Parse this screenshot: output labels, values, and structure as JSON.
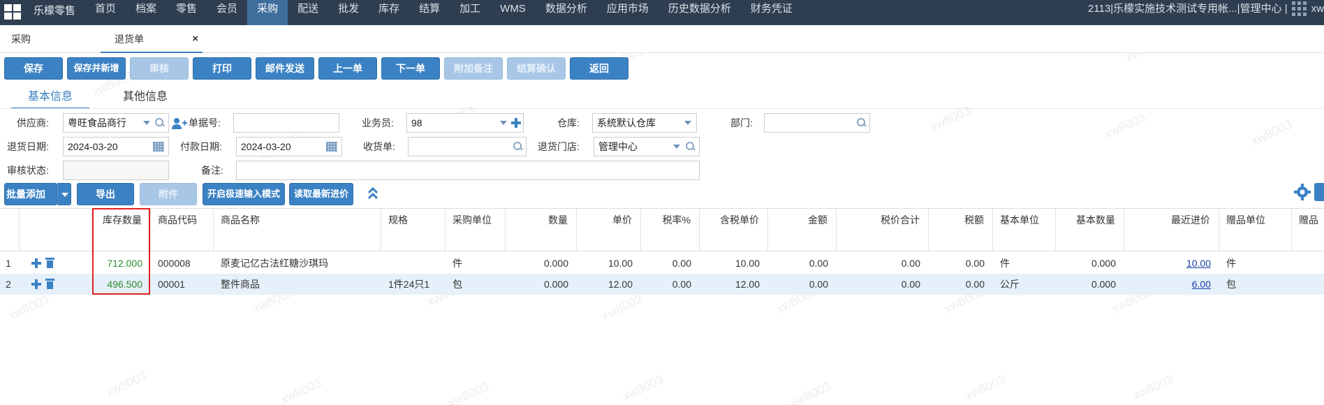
{
  "app": {
    "brand": "乐檬零售",
    "user_info": "2113|乐檬实施技术测试专用帐...|管理中心 |",
    "user": "xw"
  },
  "nav": [
    "首页",
    "档案",
    "零售",
    "会员",
    "采购",
    "配送",
    "批发",
    "库存",
    "结算",
    "加工",
    "WMS",
    "数据分析",
    "应用市场",
    "历史数据分析",
    "财务凭证"
  ],
  "nav_active": "采购",
  "tabs": {
    "purchase": "采购",
    "return": "退货单",
    "close": "×"
  },
  "toolbar": [
    "保存",
    "保存并新增",
    "审核",
    "打印",
    "邮件发送",
    "上一单",
    "下一单",
    "附加备注",
    "结算确认",
    "返回"
  ],
  "subtabs": {
    "basic": "基本信息",
    "other": "其他信息"
  },
  "form": {
    "supplier_label": "供应商:",
    "supplier_value": "粤旺食品商行",
    "doc_no_label": "单据号:",
    "doc_no_value": "",
    "salesman_label": "业务员:",
    "salesman_value": "98",
    "warehouse_label": "仓库:",
    "warehouse_value": "系统默认仓库",
    "dept_label": "部门:",
    "dept_value": "",
    "return_date_label": "退货日期:",
    "return_date_value": "2024-03-20",
    "pay_date_label": "付款日期:",
    "pay_date_value": "2024-03-20",
    "receipt_label": "收货单:",
    "receipt_value": "",
    "store_label": "退货门店:",
    "store_value": "管理中心",
    "audit_label": "审核状态:",
    "audit_value": "",
    "note_label": "备注:",
    "note_value": ""
  },
  "actions": {
    "batch_add": "批量添加",
    "export": "导出",
    "attach": "附件",
    "fast_mode": "开启极速输入模式",
    "read_price": "读取最新进价"
  },
  "table": {
    "headers": [
      "库存数量",
      "商品代码",
      "商品名称",
      "规格",
      "采购单位",
      "数量",
      "单价",
      "税率%",
      "含税单价",
      "金额",
      "税价合计",
      "税额",
      "基本单位",
      "基本数量",
      "最近进价",
      "赠品单位",
      "赠品"
    ],
    "rows": [
      {
        "no": "1",
        "stock": "712.000",
        "code": "000008",
        "name": "原麦记亿古法红糖沙琪玛",
        "spec": "",
        "unit": "件",
        "qty": "0.000",
        "price": "10.00",
        "tax": "0.00",
        "tax_price": "10.00",
        "amount": "0.00",
        "total": "0.00",
        "tax_amt": "0.00",
        "base_unit": "件",
        "base_qty": "0.000",
        "last_price": "10.00",
        "gift_unit": "件"
      },
      {
        "no": "2",
        "stock": "496.500",
        "code": "00001",
        "name": "整件商品",
        "spec": "1件24只1",
        "unit": "包",
        "qty": "0.000",
        "price": "12.00",
        "tax": "0.00",
        "tax_price": "12.00",
        "amount": "0.00",
        "total": "0.00",
        "tax_amt": "0.00",
        "base_unit": "公斤",
        "base_qty": "0.000",
        "last_price": "6.00",
        "gift_unit": "包"
      }
    ]
  },
  "watermark": "xw8003"
}
